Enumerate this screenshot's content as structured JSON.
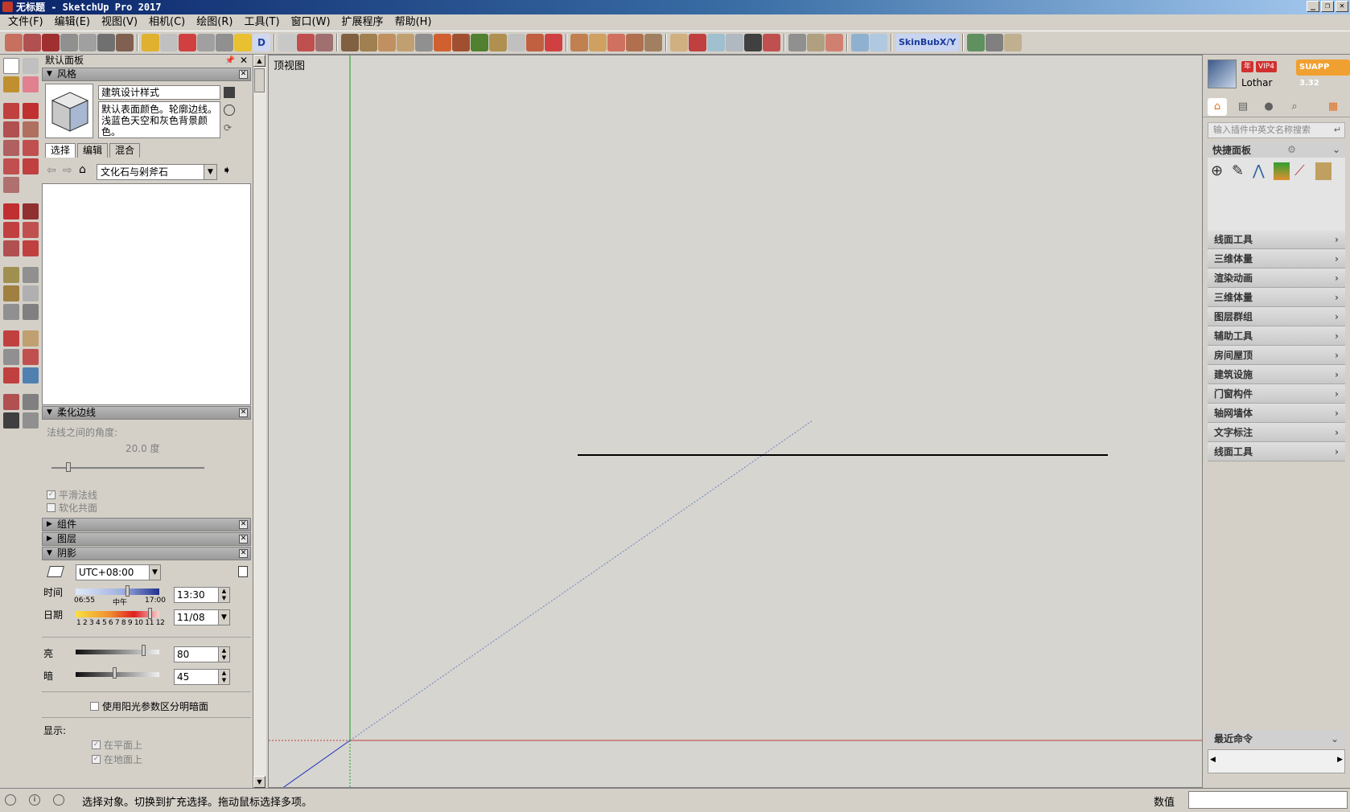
{
  "window": {
    "title": "无标题 - SketchUp Pro 2017",
    "controls": [
      "_",
      "❐",
      "✕"
    ]
  },
  "menu": [
    "文件(F)",
    "编辑(E)",
    "视图(V)",
    "相机(C)",
    "绘图(R)",
    "工具(T)",
    "窗口(W)",
    "扩展程序",
    "帮助(H)"
  ],
  "toolbar": {
    "skin_label": "SkinBubX/Y"
  },
  "tray": {
    "title": "默认面板",
    "styles": {
      "header": "风格",
      "name": "建筑设计样式",
      "description": "默认表面颜色。轮廓边线。浅蓝色天空和灰色背景颜色。",
      "tabs": [
        "选择",
        "编辑",
        "混合"
      ],
      "library": "文化石与剁斧石"
    },
    "soften": {
      "header": "柔化边线",
      "angle_label": "法线之间的角度:",
      "angle_value": "20.0 度",
      "angle_fraction": 0.11,
      "smooth_normals": "平滑法线",
      "smooth_normals_checked": true,
      "soften_coplanar": "软化共面",
      "soften_coplanar_checked": false
    },
    "components_header": "组件",
    "layers_header": "图层",
    "shadows": {
      "header": "阴影",
      "timezone": "UTC+08:00",
      "time_label": "时间",
      "time_start": "06:55",
      "time_mid": "中午",
      "time_end": "17:00",
      "time_value": "13:30",
      "date_label": "日期",
      "months": "1 2 3 4 5 6 7 8 9 10 11 12",
      "date_value": "11/08",
      "light_label": "亮",
      "light_value": "80",
      "dark_label": "暗",
      "dark_value": "45",
      "use_sun_label": "使用阳光参数区分明暗面",
      "display_label": "显示:",
      "on_faces": "在平面上",
      "on_ground": "在地面上"
    }
  },
  "viewport": {
    "view_name": "顶视图"
  },
  "siapp": {
    "user": "Lothar",
    "badge_year": "年",
    "badge_vip": "VIP4",
    "version": "SUAPP 3.32",
    "search_placeholder": "输入插件中英文名称搜索",
    "quick_panel": "快捷面板",
    "categories": [
      "线面工具",
      "三维体量",
      "渲染动画",
      "三维体量",
      "图层群组",
      "辅助工具",
      "房间屋顶",
      "建筑设施",
      "门窗构件",
      "轴网墙体",
      "文字标注",
      "线面工具"
    ],
    "recent": "最近命令"
  },
  "status": {
    "message": "选择对象。切换到扩充选择。拖动鼠标选择多项。",
    "measure_label": "数值"
  },
  "colors": {
    "axis_green": "#20a020",
    "axis_red": "#c04040",
    "axis_blue": "#2030c0",
    "title_blue": "#0a246a"
  }
}
